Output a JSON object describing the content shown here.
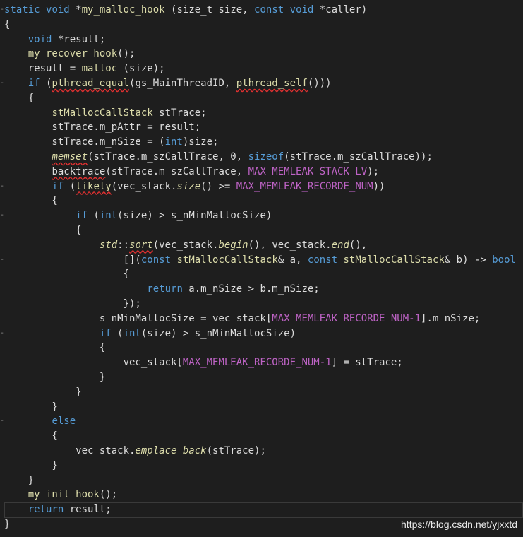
{
  "editor": {
    "language": "cpp",
    "lines": [
      {
        "fold": "-",
        "tokens": [
          [
            "kw",
            "static"
          ],
          [
            "p",
            " "
          ],
          [
            "kw",
            "void"
          ],
          [
            "p",
            " *"
          ],
          [
            "fn",
            "my_malloc_hook"
          ],
          [
            "p",
            " (size_t size, "
          ],
          [
            "kw",
            "const"
          ],
          [
            "p",
            " "
          ],
          [
            "kw",
            "void"
          ],
          [
            "p",
            " *caller)"
          ]
        ]
      },
      {
        "fold": "",
        "tokens": [
          [
            "p",
            "{"
          ]
        ]
      },
      {
        "fold": "",
        "tokens": [
          [
            "p",
            "    "
          ],
          [
            "kw",
            "void"
          ],
          [
            "p",
            " *result;"
          ]
        ]
      },
      {
        "fold": "",
        "tokens": [
          [
            "p",
            "    "
          ],
          [
            "fn",
            "my_recover_hook"
          ],
          [
            "p",
            "();"
          ]
        ]
      },
      {
        "fold": "",
        "tokens": [
          [
            "p",
            "    result = "
          ],
          [
            "fn",
            "malloc"
          ],
          [
            "p",
            " (size);"
          ]
        ]
      },
      {
        "fold": "-",
        "tokens": [
          [
            "p",
            "    "
          ],
          [
            "kw",
            "if"
          ],
          [
            "p",
            " ("
          ],
          [
            "fnsq",
            "pthread_equal"
          ],
          [
            "p",
            "(gs_MainThreadID, "
          ],
          [
            "fnsq",
            "pthread_self"
          ],
          [
            "p",
            "()))"
          ]
        ]
      },
      {
        "fold": "",
        "tokens": [
          [
            "p",
            "    {"
          ]
        ]
      },
      {
        "fold": "",
        "tokens": [
          [
            "p",
            "        "
          ],
          [
            "ty",
            "stMallocCallStack"
          ],
          [
            "p",
            " stTrace;"
          ]
        ]
      },
      {
        "fold": "",
        "tokens": [
          [
            "p",
            "        stTrace.m_pAttr = result;"
          ]
        ]
      },
      {
        "fold": "",
        "tokens": [
          [
            "p",
            "        stTrace.m_nSize = ("
          ],
          [
            "kw",
            "int"
          ],
          [
            "p",
            ")size;"
          ]
        ]
      },
      {
        "fold": "",
        "tokens": [
          [
            "p",
            "        "
          ],
          [
            "fnitsq",
            "memset"
          ],
          [
            "p",
            "(stTrace.m_szCallTrace, 0, "
          ],
          [
            "kw",
            "sizeof"
          ],
          [
            "p",
            "(stTrace.m_szCallTrace));"
          ]
        ]
      },
      {
        "fold": "",
        "tokens": [
          [
            "p",
            "        "
          ],
          [
            "psq",
            "backtrace"
          ],
          [
            "p",
            "(stTrace.m_szCallTrace, "
          ],
          [
            "mac",
            "MAX_MEMLEAK_STACK_LV"
          ],
          [
            "p",
            ");"
          ]
        ]
      },
      {
        "fold": "-",
        "tokens": [
          [
            "p",
            "        "
          ],
          [
            "kw",
            "if"
          ],
          [
            "p",
            " ("
          ],
          [
            "fnsq",
            "likely"
          ],
          [
            "p",
            "(vec_stack."
          ],
          [
            "fnit",
            "size"
          ],
          [
            "p",
            "() >= "
          ],
          [
            "mac",
            "MAX_MEMLEAK_RECORDE_NUM"
          ],
          [
            "p",
            "))"
          ]
        ]
      },
      {
        "fold": "",
        "tokens": [
          [
            "p",
            "        {"
          ]
        ]
      },
      {
        "fold": "-",
        "tokens": [
          [
            "p",
            "            "
          ],
          [
            "kw",
            "if"
          ],
          [
            "p",
            " ("
          ],
          [
            "kw",
            "int"
          ],
          [
            "p",
            "(size) > s_nMinMallocSize)"
          ]
        ]
      },
      {
        "fold": "",
        "tokens": [
          [
            "p",
            "            {"
          ]
        ]
      },
      {
        "fold": "",
        "tokens": [
          [
            "p",
            "                "
          ],
          [
            "fnit",
            "std"
          ],
          [
            "p",
            "::"
          ],
          [
            "fnitsq",
            "sort"
          ],
          [
            "p",
            "(vec_stack."
          ],
          [
            "fnit",
            "begin"
          ],
          [
            "p",
            "(), vec_stack."
          ],
          [
            "fnit",
            "end"
          ],
          [
            "p",
            "(),"
          ]
        ]
      },
      {
        "fold": "-",
        "tokens": [
          [
            "p",
            "                    []("
          ],
          [
            "kw",
            "const"
          ],
          [
            "p",
            " "
          ],
          [
            "ty",
            "stMallocCallStack"
          ],
          [
            "p",
            "& a, "
          ],
          [
            "kw",
            "const"
          ],
          [
            "p",
            " "
          ],
          [
            "ty",
            "stMallocCallStack"
          ],
          [
            "p",
            "& b) -> "
          ],
          [
            "kw",
            "bool"
          ]
        ]
      },
      {
        "fold": "",
        "tokens": [
          [
            "p",
            "                    {"
          ]
        ]
      },
      {
        "fold": "",
        "tokens": [
          [
            "p",
            "                        "
          ],
          [
            "kw",
            "return"
          ],
          [
            "p",
            " a.m_nSize > b.m_nSize;"
          ]
        ]
      },
      {
        "fold": "",
        "tokens": [
          [
            "p",
            "                    });"
          ]
        ]
      },
      {
        "fold": "",
        "tokens": [
          [
            "p",
            "                s_nMinMallocSize = vec_stack["
          ],
          [
            "mac",
            "MAX_MEMLEAK_RECORDE_NUM-1"
          ],
          [
            "p",
            "].m_nSize;"
          ]
        ]
      },
      {
        "fold": "-",
        "tokens": [
          [
            "p",
            "                "
          ],
          [
            "kw",
            "if"
          ],
          [
            "p",
            " ("
          ],
          [
            "kw",
            "int"
          ],
          [
            "p",
            "(size) > s_nMinMallocSize)"
          ]
        ]
      },
      {
        "fold": "",
        "tokens": [
          [
            "p",
            "                {"
          ]
        ]
      },
      {
        "fold": "",
        "tokens": [
          [
            "p",
            "                    vec_stack["
          ],
          [
            "mac",
            "MAX_MEMLEAK_RECORDE_NUM-1"
          ],
          [
            "p",
            "] = stTrace;"
          ]
        ]
      },
      {
        "fold": "",
        "tokens": [
          [
            "p",
            "                }"
          ]
        ]
      },
      {
        "fold": "",
        "tokens": [
          [
            "p",
            "            }"
          ]
        ]
      },
      {
        "fold": "",
        "tokens": [
          [
            "p",
            "        }"
          ]
        ]
      },
      {
        "fold": "-",
        "tokens": [
          [
            "p",
            "        "
          ],
          [
            "kw",
            "else"
          ]
        ]
      },
      {
        "fold": "",
        "tokens": [
          [
            "p",
            "        {"
          ]
        ]
      },
      {
        "fold": "",
        "tokens": [
          [
            "p",
            "            vec_stack."
          ],
          [
            "fnit",
            "emplace_back"
          ],
          [
            "p",
            "(stTrace);"
          ]
        ]
      },
      {
        "fold": "",
        "tokens": [
          [
            "p",
            "        }"
          ]
        ]
      },
      {
        "fold": "",
        "tokens": [
          [
            "p",
            "    }"
          ]
        ]
      },
      {
        "fold": "",
        "tokens": [
          [
            "p",
            "    "
          ],
          [
            "fn",
            "my_init_hook"
          ],
          [
            "p",
            "();"
          ]
        ]
      },
      {
        "fold": "",
        "tokens": [
          [
            "p",
            "    "
          ],
          [
            "kw",
            "return"
          ],
          [
            "p",
            " result;"
          ]
        ],
        "current": true
      },
      {
        "fold": "",
        "tokens": [
          [
            "p",
            "}"
          ]
        ]
      }
    ]
  },
  "watermark": "https://blog.csdn.net/yjxxtd"
}
